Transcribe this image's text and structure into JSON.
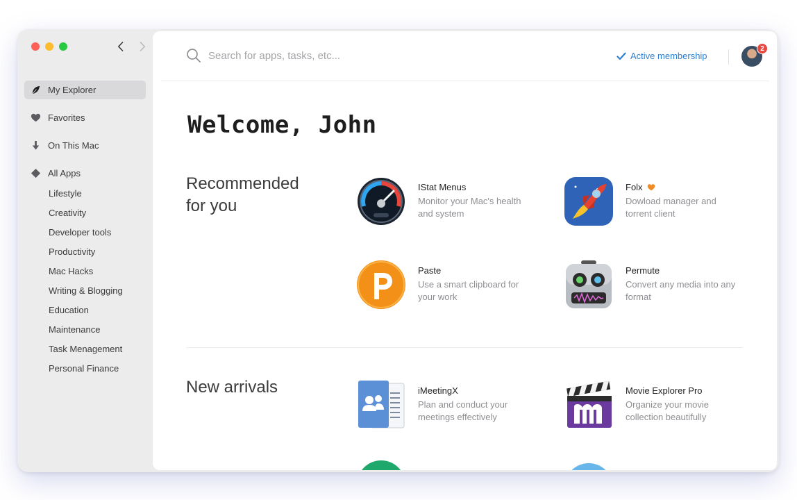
{
  "sidebar": {
    "nav": [
      {
        "label": "My Explorer",
        "icon": "leaf-icon",
        "active": true
      },
      {
        "label": "Favorites",
        "icon": "heart-icon"
      },
      {
        "label": "On This Mac",
        "icon": "download-arrow-icon"
      },
      {
        "label": "All Apps",
        "icon": "diamond-icon"
      }
    ],
    "categories": [
      "Lifestyle",
      "Creativity",
      "Developer tools",
      "Productivity",
      "Mac Hacks",
      "Writing & Blogging",
      "Education",
      "Maintenance",
      "Task Menagement",
      "Personal Finance"
    ]
  },
  "topbar": {
    "search_placeholder": "Search for apps, tasks, etc...",
    "membership": "Active membership",
    "notification_count": "2"
  },
  "welcome": "Welcome, John",
  "sections": {
    "recommended": {
      "title": "Recommended for you",
      "apps": [
        {
          "name": "IStat Menus",
          "desc": "Monitor your Mac's health and system",
          "icon": "gauge-icon"
        },
        {
          "name": "Folx",
          "desc": "Dowload manager and torrent client",
          "icon": "rocket-icon",
          "favorite_icon": "heart-icon"
        },
        {
          "name": "Paste",
          "desc": "Use a smart clipboard for your work",
          "icon": "paste-p-icon"
        },
        {
          "name": "Permute",
          "desc": "Convert any media into any format",
          "icon": "robot-icon"
        }
      ]
    },
    "new_arrivals": {
      "title": "New arrivals",
      "apps": [
        {
          "name": "iMeetingX",
          "desc": "Plan and conduct your meetings effectively",
          "icon": "meeting-document-icon"
        },
        {
          "name": "Movie Explorer Pro",
          "desc": "Organize your movie collection beautifully",
          "icon": "clapperboard-icon"
        }
      ]
    }
  },
  "colors": {
    "accent": "#2f7fd0",
    "favorite": "#f08a24",
    "badge": "#e5493f"
  }
}
